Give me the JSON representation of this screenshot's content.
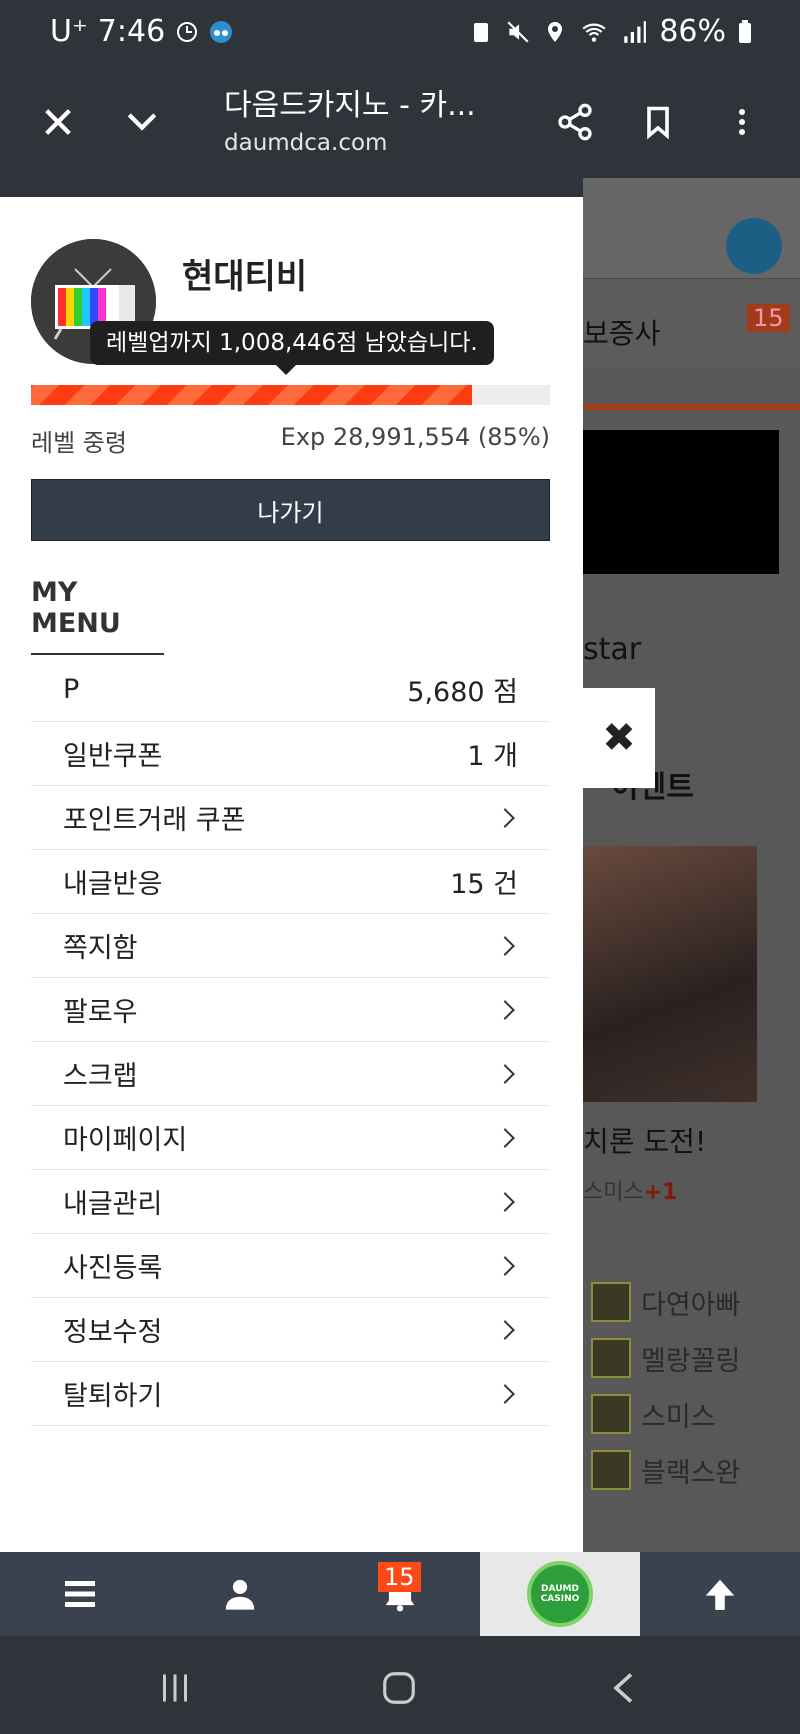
{
  "status_bar": {
    "carrier": "U⁺",
    "time": "7:46",
    "battery": "86%"
  },
  "browser": {
    "title": "다음드카지노 - 카...",
    "url": "daumdca.com"
  },
  "profile": {
    "username": "현대티비",
    "tooltip": "레벨업까지 1,008,446점 남았습니다.",
    "progress_percent": 85,
    "level_label": "레벨 중령",
    "exp_text": "Exp 28,991,554 (85%)",
    "logout_label": "나가기"
  },
  "my_menu": {
    "heading": "MY MENU",
    "items": [
      {
        "label": "P",
        "value": "5,680 점",
        "name": "menu-item-points"
      },
      {
        "label": "일반쿠폰",
        "value": "1 개",
        "name": "menu-item-coupon"
      },
      {
        "label": "포인트거래 쿠폰",
        "value": "",
        "name": "menu-item-point-trade-coupon"
      },
      {
        "label": "내글반응",
        "value": "15 건",
        "name": "menu-item-reactions"
      },
      {
        "label": "쪽지함",
        "value": "",
        "name": "menu-item-messages"
      },
      {
        "label": "팔로우",
        "value": "",
        "name": "menu-item-follow"
      },
      {
        "label": "스크랩",
        "value": "",
        "name": "menu-item-scrap"
      },
      {
        "label": "마이페이지",
        "value": "",
        "name": "menu-item-mypage"
      },
      {
        "label": "내글관리",
        "value": "",
        "name": "menu-item-my-posts"
      },
      {
        "label": "사진등록",
        "value": "",
        "name": "menu-item-photo-upload"
      },
      {
        "label": "정보수정",
        "value": "",
        "name": "menu-item-edit-info"
      },
      {
        "label": "탈퇴하기",
        "value": "",
        "name": "menu-item-withdraw"
      }
    ]
  },
  "background_page": {
    "badge_count": "15",
    "guarantee_label": "보증사",
    "star_label": "star",
    "event_label": "이벤트",
    "challenge_label": "치론 도전!",
    "sub_label": "스미스",
    "plus": "+1",
    "ranking": [
      "다연아빠",
      "멜랑꼴링",
      "스미스",
      "블랙스완"
    ]
  },
  "bottom_nav": {
    "notification_count": "15",
    "logo_text": "DAUMD CASINO"
  },
  "close_label": "✖"
}
